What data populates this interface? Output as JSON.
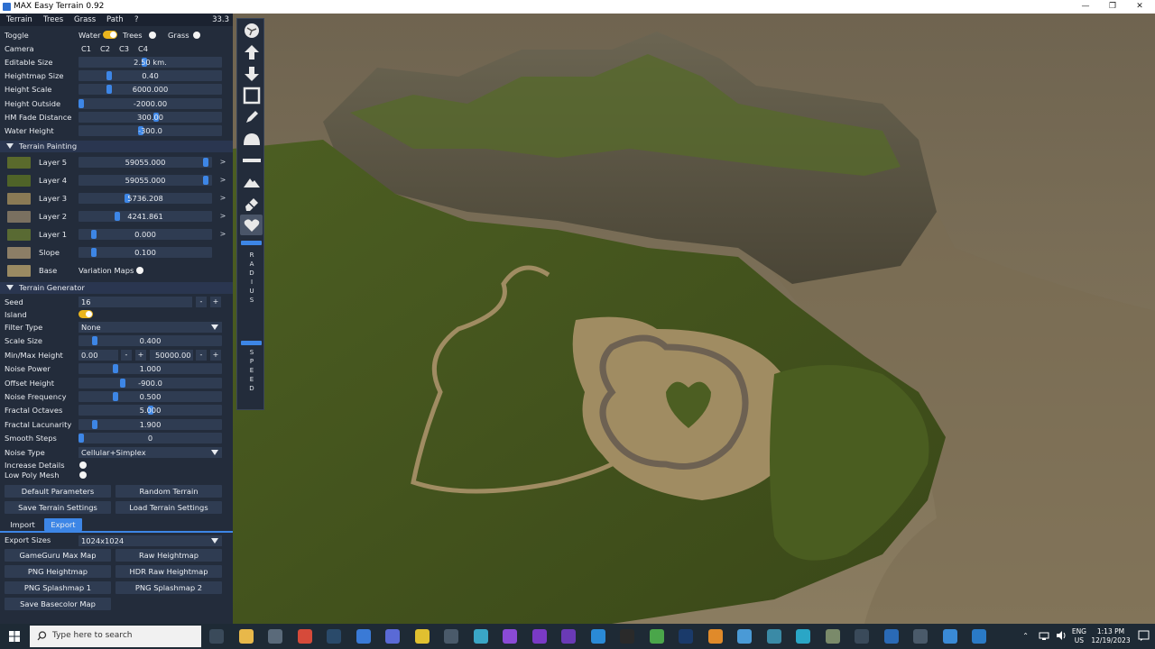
{
  "window": {
    "title": "MAX Easy Terrain 0.92",
    "controls": [
      "—",
      "❐",
      "✕"
    ]
  },
  "menu": {
    "items": [
      "Terrain",
      "Trees",
      "Grass",
      "Path",
      "?"
    ],
    "fps": "33.3"
  },
  "toggle_row": {
    "label": "Toggle",
    "water": "Water",
    "trees": "Trees",
    "grass": "Grass"
  },
  "camera": {
    "label": "Camera",
    "buttons": [
      "C1",
      "C2",
      "C3",
      "C4"
    ]
  },
  "settings": [
    {
      "label": "Editable Size",
      "value": "2.50 km.",
      "level": 0.46
    },
    {
      "label": "Heightmap Size",
      "value": "0.40",
      "level": 0.2
    },
    {
      "label": "Height Scale",
      "value": "6000.000",
      "level": 0.2
    },
    {
      "label": "Height Outside",
      "value": "-2000.00",
      "level": 0.0
    },
    {
      "label": "HM Fade Distance",
      "value": "300.00",
      "level": 0.54
    },
    {
      "label": "Water Height",
      "value": "-300.0",
      "level": 0.43
    }
  ],
  "terrain_painting": {
    "header": "Terrain Painting",
    "layers": [
      {
        "label": "Layer 5",
        "value": "59055.000",
        "level": 0.97,
        "color": "#5a6a2c"
      },
      {
        "label": "Layer 4",
        "value": "59055.000",
        "level": 0.97,
        "color": "#4f6328"
      },
      {
        "label": "Layer 3",
        "value": "5736.208",
        "level": 0.36,
        "color": "#8a7a55"
      },
      {
        "label": "Layer 2",
        "value": "4241.861",
        "level": 0.28,
        "color": "#7a7060"
      },
      {
        "label": "Layer 1",
        "value": "0.000",
        "level": 0.1,
        "color": "#596a33"
      },
      {
        "label": "Slope",
        "value": "0.100",
        "level": 0.1,
        "color": "#8c7e66"
      }
    ],
    "base": {
      "label": "Base",
      "variation": "Variation Maps",
      "color": "#9a8a62"
    }
  },
  "terrain_generator": {
    "header": "Terrain Generator",
    "seed": {
      "label": "Seed",
      "value": "16"
    },
    "island": {
      "label": "Island"
    },
    "filter_type": {
      "label": "Filter Type",
      "value": "None"
    },
    "scale_size": {
      "label": "Scale Size",
      "value": "0.400",
      "level": 0.1
    },
    "minmax": {
      "label": "Min/Max Height",
      "min": "0.00",
      "max": "50000.00"
    },
    "params": [
      {
        "label": "Noise Power",
        "value": "1.000",
        "level": 0.25
      },
      {
        "label": "Offset Height",
        "value": "-900.0",
        "level": 0.3
      },
      {
        "label": "Noise Frequency",
        "value": "0.500",
        "level": 0.25
      },
      {
        "label": "Fractal Octaves",
        "value": "5.000",
        "level": 0.5
      },
      {
        "label": "Fractal Lacunarity",
        "value": "1.900",
        "level": 0.1
      },
      {
        "label": "Smooth Steps",
        "value": "0",
        "level": 0.0
      }
    ],
    "noise_type": {
      "label": "Noise Type",
      "value": "Cellular+Simplex"
    },
    "increase_details": "Increase Details",
    "low_poly": "Low Poly Mesh",
    "buttons": [
      "Default Parameters",
      "Random Terrain",
      "Save Terrain Settings",
      "Load Terrain Settings"
    ]
  },
  "tabs": {
    "import": "Import",
    "export": "Export"
  },
  "export": {
    "sizes_label": "Export Sizes",
    "sizes_value": "1024x1024",
    "buttons": [
      "GameGuru Max Map",
      "Raw Heightmap",
      "PNG Heightmap",
      "HDR Raw Heightmap",
      "PNG Splashmap 1",
      "PNG Splashmap 2",
      "Save Basecolor Map"
    ]
  },
  "toolbar": {
    "radius_letters": [
      "R",
      "A",
      "D",
      "I",
      "U",
      "S"
    ],
    "speed_letters": [
      "S",
      "P",
      "E",
      "E",
      "D"
    ]
  },
  "taskbar": {
    "search_placeholder": "Type here to search",
    "lang": "ENG",
    "region": "US",
    "time": "1:13 PM",
    "date": "12/19/2023"
  }
}
